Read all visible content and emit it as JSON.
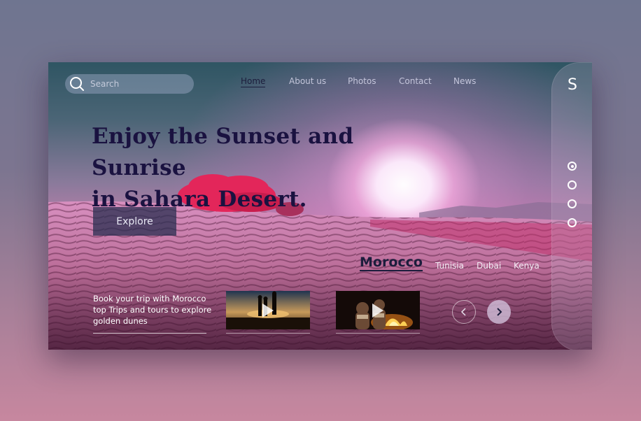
{
  "search": {
    "placeholder": "Search"
  },
  "nav": {
    "items": [
      {
        "label": "Home",
        "active": true
      },
      {
        "label": "About us",
        "active": false
      },
      {
        "label": "Photos",
        "active": false
      },
      {
        "label": "Contact",
        "active": false
      },
      {
        "label": "News",
        "active": false
      }
    ]
  },
  "brand": {
    "logo": "S"
  },
  "hero": {
    "title_line1": "Enjoy the Sunset and Sunrise",
    "title_line2": "in Sahara Desert.",
    "explore_label": "Explore"
  },
  "slider": {
    "count": 4,
    "active_index": 0
  },
  "destinations": {
    "active": "Morocco",
    "others": [
      "Tunisia",
      "Dubai",
      "Kenya"
    ]
  },
  "promo": {
    "text": "Book your trip with Morocco top Trips and tours to explore golden dunes"
  },
  "videos": [
    {
      "icon": "play-icon"
    },
    {
      "icon": "play-icon"
    }
  ],
  "carousel": {
    "prev_icon": "chevron-left-icon",
    "next_icon": "chevron-right-icon"
  },
  "colors": {
    "headline": "#1a1240",
    "explore_bg": "#2d3258",
    "accent_dark": "#1c1d3c"
  }
}
